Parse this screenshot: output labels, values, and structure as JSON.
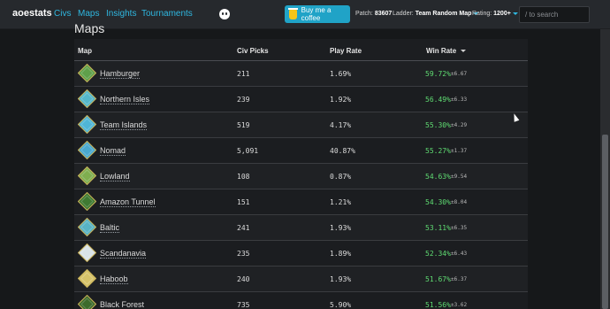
{
  "header": {
    "brand": "aoestats",
    "nav": [
      "Civs",
      "Maps",
      "Insights",
      "Tournaments"
    ],
    "discord_icon": "discord-icon",
    "coffee_label": "Buy me a coffee",
    "patch_label": "Patch:",
    "patch_value": "83607",
    "ladder_label": "Ladder:",
    "ladder_value": "Team Random Map",
    "rating_label": "Rating:",
    "rating_value": "1200+",
    "search_placeholder": "/ to search",
    "accent": "#2fb7e0"
  },
  "section": {
    "title": "Maps"
  },
  "table": {
    "columns": [
      "Map",
      "Civ Picks",
      "Play Rate",
      "Win Rate"
    ],
    "sorted_by": "Win Rate",
    "sort_direction": "descending",
    "win_color": "#5fdc72",
    "rows": [
      {
        "map": "Hamburger",
        "civ_picks": "211",
        "play_rate": "1.69%",
        "win_rate": "59.72%",
        "err": "±6.67",
        "icon_color": "#5fa04a"
      },
      {
        "map": "Northern Isles",
        "civ_picks": "239",
        "play_rate": "1.92%",
        "win_rate": "56.49%",
        "err": "±6.33",
        "icon_color": "#55b7c9"
      },
      {
        "map": "Team Islands",
        "civ_picks": "519",
        "play_rate": "4.17%",
        "win_rate": "55.30%",
        "err": "±4.29",
        "icon_color": "#4fb5d6"
      },
      {
        "map": "Nomad",
        "civ_picks": "5,091",
        "play_rate": "40.87%",
        "win_rate": "55.27%",
        "err": "±1.37",
        "icon_color": "#4aa9cf"
      },
      {
        "map": "Lowland",
        "civ_picks": "108",
        "play_rate": "0.87%",
        "win_rate": "54.63%",
        "err": "±9.54",
        "icon_color": "#7fae4f"
      },
      {
        "map": "Amazon Tunnel",
        "civ_picks": "151",
        "play_rate": "1.21%",
        "win_rate": "54.30%",
        "err": "±8.04",
        "icon_color": "#3f7a32"
      },
      {
        "map": "Baltic",
        "civ_picks": "241",
        "play_rate": "1.93%",
        "win_rate": "53.11%",
        "err": "±6.35",
        "icon_color": "#58b3c4"
      },
      {
        "map": "Scandanavia",
        "civ_picks": "235",
        "play_rate": "1.89%",
        "win_rate": "52.34%",
        "err": "±6.43",
        "icon_color": "#d9e3e8"
      },
      {
        "map": "Haboob",
        "civ_picks": "240",
        "play_rate": "1.93%",
        "win_rate": "51.67%",
        "err": "±6.37",
        "icon_color": "#d6c36a"
      },
      {
        "map": "Black Forest",
        "civ_picks": "735",
        "play_rate": "5.90%",
        "win_rate": "51.56%",
        "err": "±3.62",
        "icon_color": "#3d6b2c"
      }
    ]
  }
}
